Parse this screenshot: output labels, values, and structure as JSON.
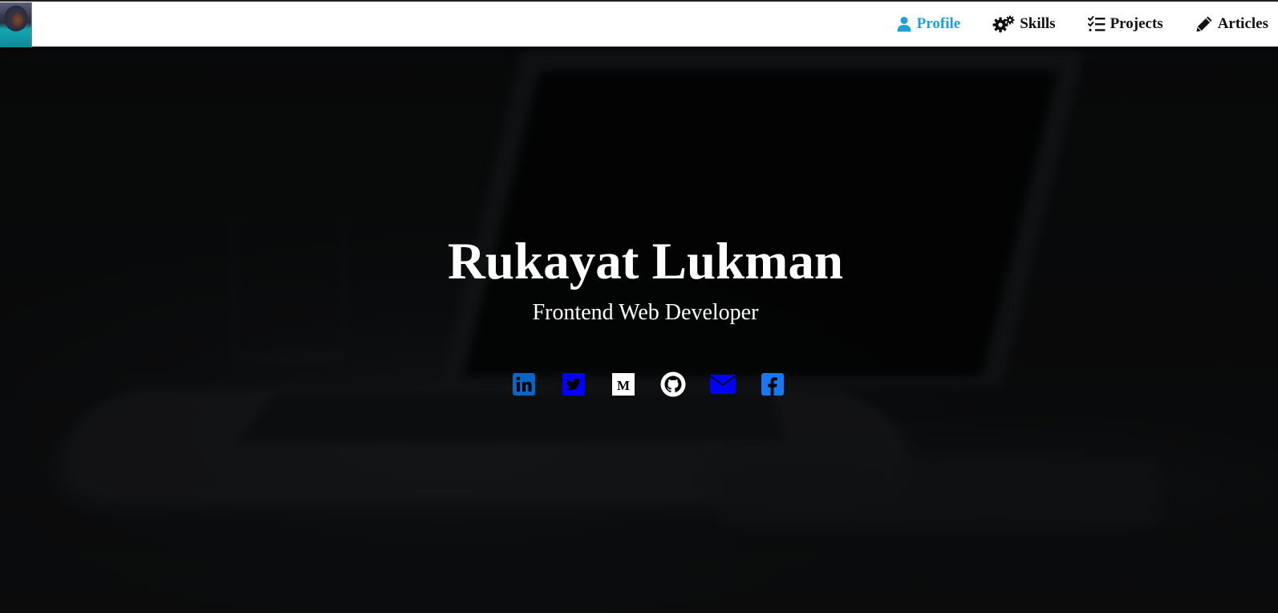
{
  "nav": {
    "items": [
      {
        "label": "Profile",
        "icon": "user-icon",
        "active": true
      },
      {
        "label": "Skills",
        "icon": "gears-icon",
        "active": false
      },
      {
        "label": "Projects",
        "icon": "tasks-icon",
        "active": false
      },
      {
        "label": "Articles",
        "icon": "pencil-icon",
        "active": false
      }
    ],
    "active_color": "#1e9fd8",
    "text_color": "#111111"
  },
  "hero": {
    "name": "Rukayat Lukman",
    "role": "Frontend Web Developer"
  },
  "socials": [
    {
      "icon": "linkedin-icon",
      "color": "#0a66c2"
    },
    {
      "icon": "twitter-icon",
      "color": "#0000ff"
    },
    {
      "icon": "medium-icon",
      "color": "#ffffff"
    },
    {
      "icon": "github-icon",
      "color": "#ffffff"
    },
    {
      "icon": "email-icon",
      "color": "#0000ff"
    },
    {
      "icon": "facebook-icon",
      "color": "#1877f2"
    }
  ]
}
